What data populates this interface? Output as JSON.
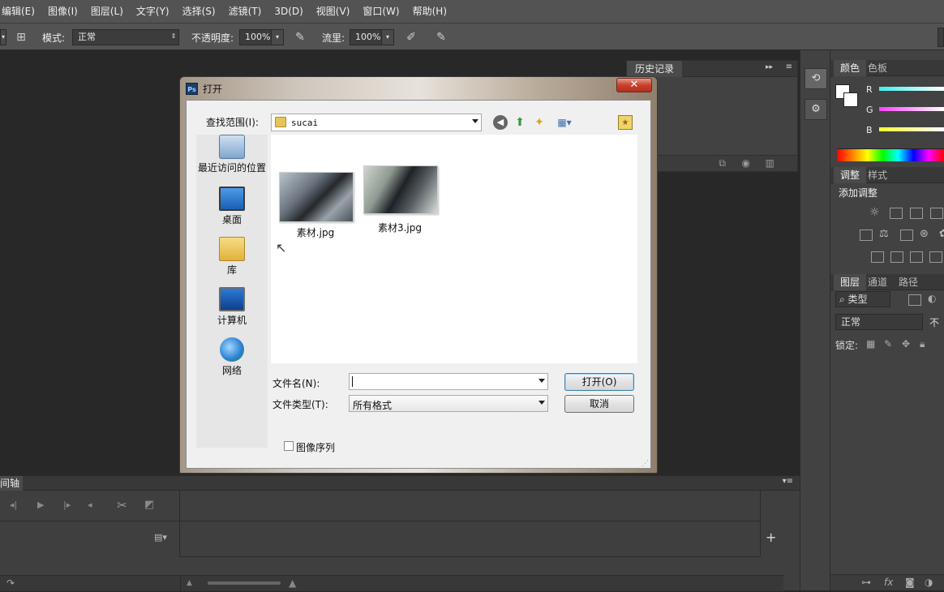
{
  "menu": [
    "编辑(E)",
    "图像(I)",
    "图层(L)",
    "文字(Y)",
    "选择(S)",
    "滤镜(T)",
    "3D(D)",
    "视图(V)",
    "窗口(W)",
    "帮助(H)"
  ],
  "options": {
    "mode_label": "模式:",
    "mode_value": "正常",
    "opacity_label": "不透明度:",
    "opacity_value": "100%",
    "flow_label": "流里:",
    "flow_value": "100%"
  },
  "history_panel": {
    "tab": "历史记录"
  },
  "color_panel": {
    "tabs": [
      "颜色",
      "色板"
    ],
    "channels": [
      "R",
      "G",
      "B"
    ]
  },
  "adjust_panel": {
    "tabs": [
      "调整",
      "样式"
    ],
    "title": "添加调整"
  },
  "layers_panel": {
    "tabs": [
      "图层",
      "通道",
      "路径"
    ],
    "filter_label": "类型",
    "blend_mode": "正常",
    "opacity_label": "不",
    "lock_label": "锁定:"
  },
  "timeline": {
    "tab": "间轴"
  },
  "dialog": {
    "title": "打开",
    "close_glyph": "✕",
    "lookin_label": "查找范围(I):",
    "lookin_value": "sucai",
    "places": [
      "最近访问的位置",
      "桌面",
      "库",
      "计算机",
      "网络"
    ],
    "files": [
      "素材.jpg",
      "素材3.jpg"
    ],
    "filename_label": "文件名(N):",
    "filename_value": "",
    "filetype_label": "文件类型(T):",
    "filetype_value": "所有格式",
    "open_button": "打开(O)",
    "cancel_button": "取消",
    "image_sequence_label": "图像序列"
  }
}
